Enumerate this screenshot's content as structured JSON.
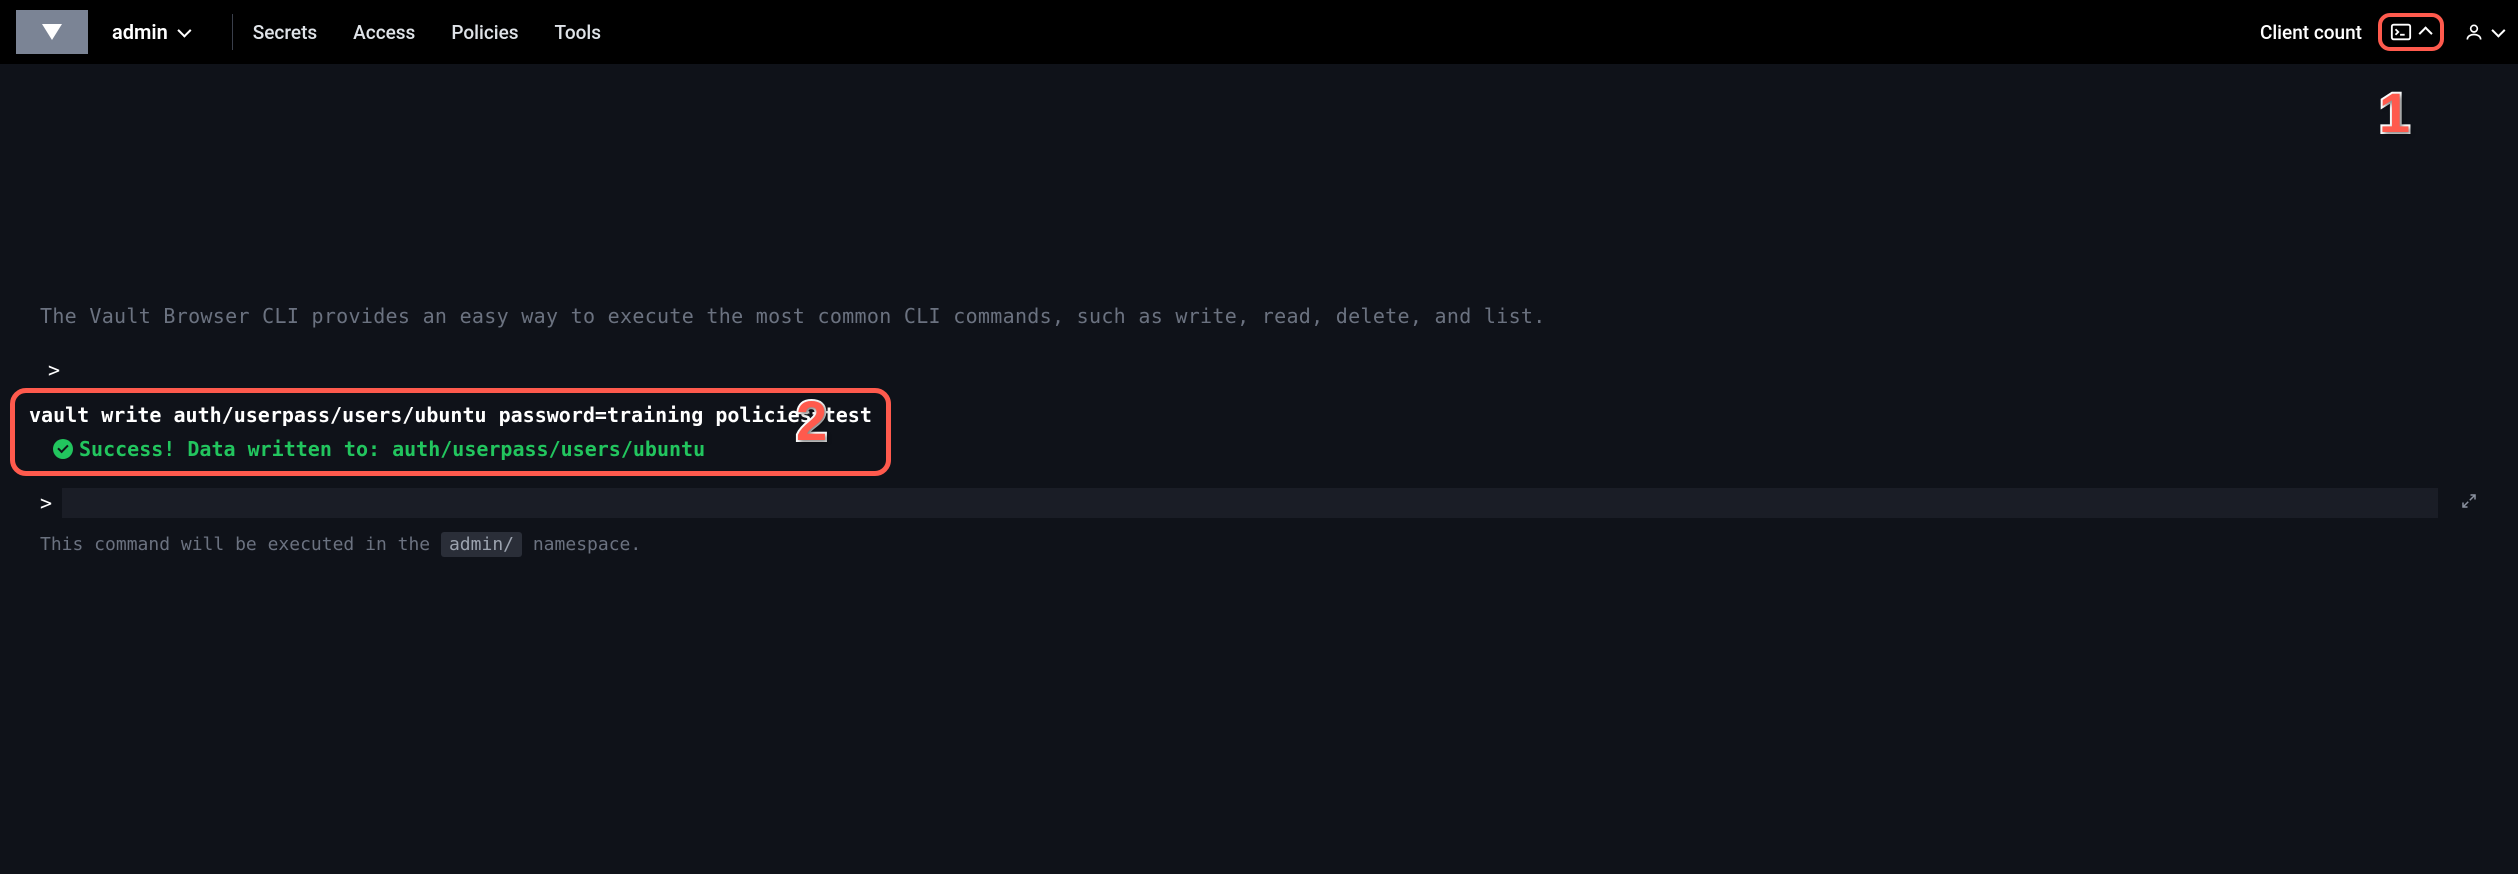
{
  "header": {
    "namespace": "admin",
    "nav": {
      "secrets": "Secrets",
      "access": "Access",
      "policies": "Policies",
      "tools": "Tools"
    },
    "client_count": "Client count"
  },
  "annotations": {
    "one": "1",
    "two": "2"
  },
  "console": {
    "description": "The Vault Browser CLI provides an easy way to execute the most common CLI commands, such as write, read, delete, and list.",
    "prompt": ">",
    "command": "vault write auth/userpass/users/ubuntu password=training policies=test",
    "success": "Success! Data written to: auth/userpass/users/ubuntu",
    "input_value": "",
    "hint_prefix": "This command will be executed in the ",
    "hint_namespace": "admin/",
    "hint_suffix": " namespace."
  },
  "colors": {
    "accent_highlight": "#ff5a4d",
    "success": "#22c55e",
    "bg": "#0f1219"
  }
}
